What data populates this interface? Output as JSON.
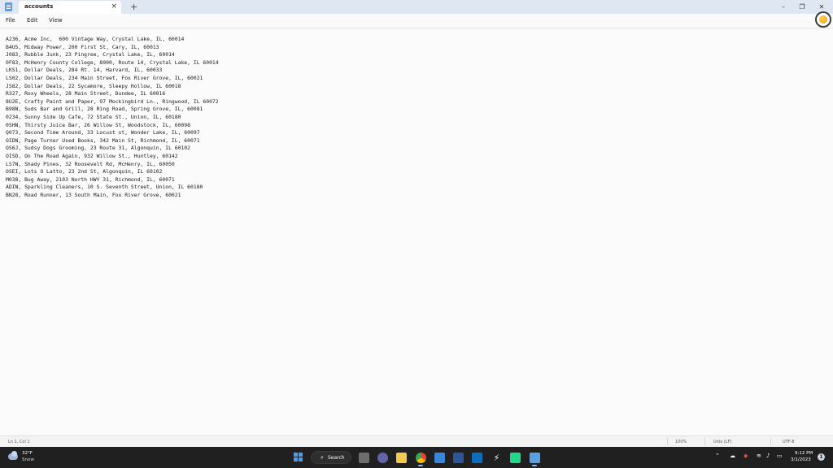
{
  "window": {
    "tab_title": "accounts",
    "tab_close": "×",
    "new_tab": "+",
    "minimize": "–",
    "maximize": "❐",
    "close": "✕"
  },
  "menu": {
    "file": "File",
    "edit": "Edit",
    "view": "View"
  },
  "document": {
    "lines": [
      "A236, Acme Inc,  600 Vintage Way, Crystal Lake, IL, 60014",
      "B4U5, Midway Power, 200 First St, Cary, IL, 60013",
      "J083, Rubble Junk, 23 Pingree, Crystal Lake, IL, 60014",
      "0F83, McHenry County College, 8900, Route 14, Crystal Lake, IL 60014",
      "LKS1, Dollar Deals, 284 Rt. 14, Harvard, IL, 60033",
      "LS02, Dollar Deals, 234 Main Street, Fox River Grove, IL, 60021",
      "JS82, Dollar Deals, 22 Sycamore, Sleepy Hollow, IL 60018",
      "R327, Roxy Wheels, 28 Main Street, Dundee, IL 60016",
      "8U2E, Crafty Paint and Paper, 97 Mockingbird Ln., Ringwood, IL 60072",
      "B98N, Suds Bar and Grill, 28 Ring Road, Spring Grove, IL, 60081",
      "0234, Sunny Side Up Cafe, 72 State St., Union, IL, 60180",
      "0SHN, Thirsty Juice Bar, 26 Willow St, Woodstock, IL, 60098",
      "Q073, Second Time Around, 33 Locust st, Wonder Lake, IL, 60097",
      "OIDN, Page Turner Used Books, 342 Main St, Richmond, IL, 60071",
      "OS6J, Sudsy Dogs Grooming, 23 Route 31, Algonquin, IL 60102",
      "OISD, On The Road Again, 932 Willow St., Huntley, 60142",
      "LS7N, Shady Pines, 32 Roosevelt Rd, McHenry, IL, 60050",
      "OSEI, Lots O Latto, 23 2nd St, Algonquin, IL 60102",
      "M038, Bug Away, 2103 North HWY 31, Richmond, IL, 60071",
      "ADIN, Sparkling Cleaners, 10 S. Seventh Street, Union, IL 60180",
      "BN28, Road Runner, 13 South Main, Fox River Grove, 60021"
    ]
  },
  "status": {
    "position": "Ln 1, Col 1",
    "zoom": "100%",
    "line_ending": "Unix (LF)",
    "encoding": "UTF-8"
  },
  "taskbar": {
    "temperature": "32°F",
    "condition": "Snow",
    "search_label": "Search",
    "time": "9:12 PM",
    "date": "3/1/2023",
    "notification_count": "1"
  }
}
